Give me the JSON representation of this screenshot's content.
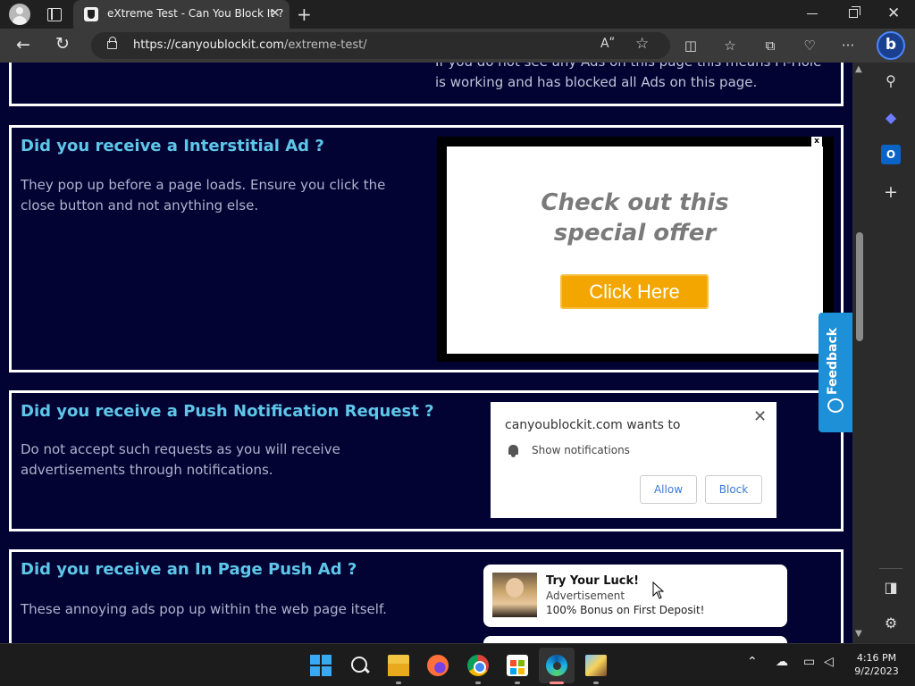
{
  "browser": {
    "tab_title": "eXtreme Test - Can You Block It ?",
    "tab_close": "✕",
    "new_tab": "+",
    "url_host": "https://canyoublockit.com",
    "url_path": "/extreme-test/",
    "read_aloud": "Aʺ",
    "favorite": "☆",
    "window_close": "✕",
    "bing_label": "b"
  },
  "page": {
    "pihole_text": "If you do not see any Ads on this page this means Pi-Hole is working and has blocked all Ads on this page.",
    "sections": [
      {
        "heading": "Did you receive a Interstitial Ad ?",
        "text": "They pop up before a page loads. Ensure you click the close button and not anything else."
      },
      {
        "heading": "Did you receive a Push Notification Request ?",
        "text": "Do not accept such requests as you will receive advertisements through notifications."
      },
      {
        "heading": "Did you receive an In Page Push Ad ?",
        "text": "These annoying ads pop up within the web page itself."
      }
    ],
    "interstitial": {
      "close": "x",
      "offer_line1": "Check out this",
      "offer_line2": "special offer",
      "button": "Click Here"
    },
    "notification": {
      "title": "canyoublockit.com wants to",
      "permission": "Show notifications",
      "allow": "Allow",
      "block": "Block",
      "close": "✕"
    },
    "in_page_push": {
      "title": "Try Your Luck!",
      "subtitle": "Advertisement",
      "body": "100% Bonus on First Deposit!"
    },
    "feedback": "Feedback"
  },
  "taskbar": {
    "time": "4:16 PM",
    "date": "9/2/2023"
  },
  "colors": {
    "page_bg": "#020333",
    "heading": "#5ec7e9",
    "body_text": "#aeb3cc",
    "cta": "#f4a600",
    "feedback": "#1e90d8"
  }
}
